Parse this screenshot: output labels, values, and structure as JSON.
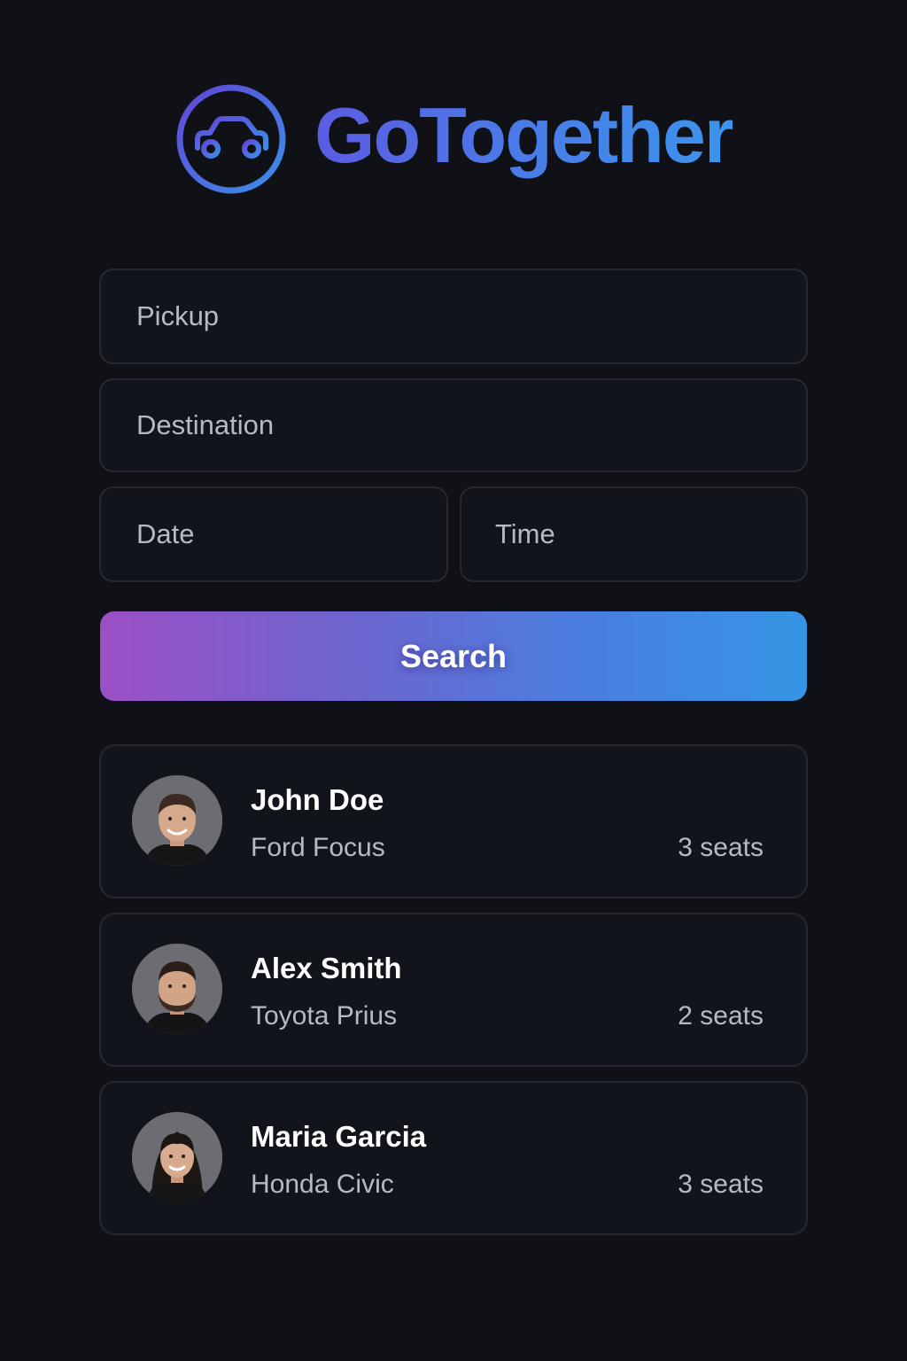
{
  "app": {
    "name": "GoTogether",
    "logo_icon": "car-icon",
    "accent_gradient": [
      "#5b5ce0",
      "#3b95ec"
    ]
  },
  "form": {
    "pickup_placeholder": "Pickup",
    "destination_placeholder": "Destination",
    "date_placeholder": "Date",
    "time_placeholder": "Time",
    "search_label": "Search",
    "search_gradient": [
      "#9b4fc5",
      "#3495e5"
    ]
  },
  "rides": [
    {
      "driver": "John Doe",
      "car": "Ford Focus",
      "seats": "3 seats",
      "avatar": "avatar-photo"
    },
    {
      "driver": "Alex Smith",
      "car": "Toyota Prius",
      "seats": "2 seats",
      "avatar": "avatar-photo"
    },
    {
      "driver": "Maria Garcia",
      "car": "Honda Civic",
      "seats": "3 seats",
      "avatar": "avatar-photo"
    }
  ],
  "colors": {
    "background": "#0f1117",
    "card": "#12141b",
    "border": "#252833",
    "muted_text": "#b6bac4"
  }
}
